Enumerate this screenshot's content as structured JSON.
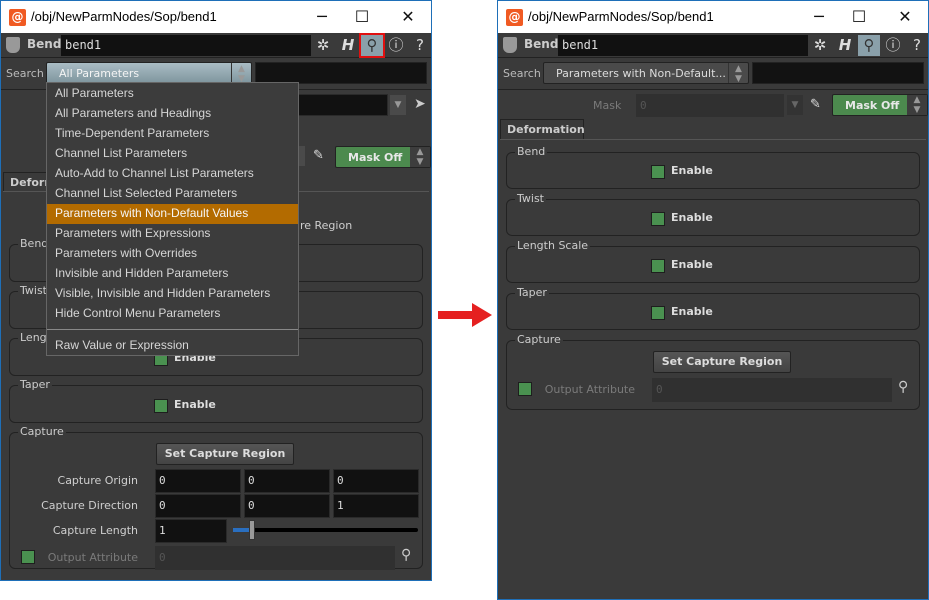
{
  "left": {
    "title": "/obj/NewParmNodes/Sop/bend1",
    "node_type": "Bend",
    "node_name": "bend1",
    "search_label": "Search",
    "search_value": "All Parameters",
    "menu": [
      "All Parameters",
      "All Parameters and Headings",
      "Time-Dependent Parameters",
      "Channel List Parameters",
      "Auto-Add to Channel List Parameters",
      "Channel List Selected Parameters",
      "Parameters with Non-Default Values",
      "Parameters with Expressions",
      "Parameters with Overrides",
      "Invisible and Hidden Parameters",
      "Visible, Invisible and Hidden Parameters",
      "Hide Control Menu Parameters",
      "Raw Value or Expression"
    ],
    "menu_highlight": "Parameters with Non-Default Values",
    "mask_off": "Mask Off",
    "tab": "Deformation",
    "partial_button": "ure Region",
    "groups": {
      "bend": "Bend",
      "twist": "Twist",
      "length": "Lengt",
      "taper": "Taper",
      "capture": "Capture"
    },
    "enable": "Enable",
    "set_capture": "Set Capture Region",
    "capture_origin": {
      "label": "Capture Origin",
      "values": [
        "0",
        "0",
        "0"
      ]
    },
    "capture_direction": {
      "label": "Capture Direction",
      "values": [
        "0",
        "0",
        "1"
      ]
    },
    "capture_length": {
      "label": "Capture Length",
      "value": "1",
      "slider_fraction": 0.1
    },
    "output_attribute": {
      "label": "Output Attribute",
      "value": "0"
    }
  },
  "right": {
    "title": "/obj/NewParmNodes/Sop/bend1",
    "node_type": "Bend",
    "node_name": "bend1",
    "search_label": "Search",
    "search_value": "Parameters with Non-Default...",
    "mask_label": "Mask",
    "mask_value": "0",
    "mask_off": "Mask Off",
    "tab": "Deformation",
    "groups": {
      "bend": "Bend",
      "twist": "Twist",
      "length": "Length Scale",
      "taper": "Taper",
      "capture": "Capture"
    },
    "enable": "Enable",
    "set_capture": "Set Capture Region",
    "output_attribute": {
      "label": "Output Attribute",
      "value": "0"
    }
  },
  "colors": {
    "highlight": "#b36b00",
    "mask_off": "#4c8a4e",
    "checkbox": "#4a9150",
    "arrow": "#e52020",
    "window_border": "#1e6fb8"
  }
}
